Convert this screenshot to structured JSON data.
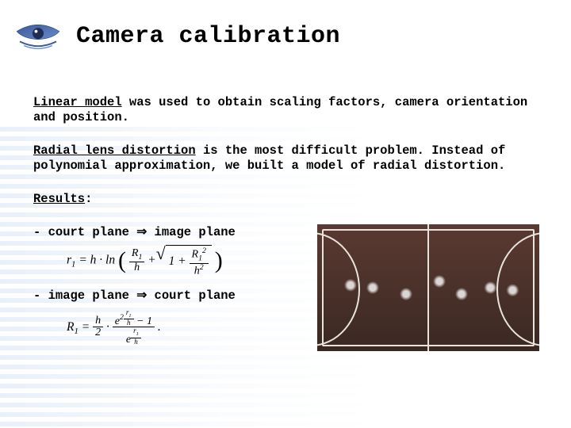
{
  "title": "Camera calibration",
  "body": {
    "p1_lead": "Linear model",
    "p1_rest": " was used to obtain scaling factors, camera orientation and position.",
    "p2_lead": "Radial lens distortion",
    "p2_rest": " is the most difficult problem. Instead of polynomial approximation, we built a model of radial distortion.",
    "results_label": "Results",
    "colon": ":",
    "map1_pre": "- court plane ",
    "map1_post": " image plane",
    "map2_pre": "- image plane ",
    "map2_post": " court plane",
    "arrow": "⇒"
  },
  "formulas": {
    "f1": {
      "lhs": "r",
      "lhs_sub": "1",
      "eq": " = h · ln",
      "frac1_num_a": "R",
      "frac1_num_sub": "1",
      "frac1_den": "h",
      "plus": " + ",
      "one_plus": "1 + ",
      "frac2_num_a": "R",
      "frac2_num_sub": "1",
      "frac2_num_sup": "2",
      "frac2_den_a": "h",
      "frac2_den_sup": "2"
    },
    "f2": {
      "lhs": "R",
      "lhs_sub": "1",
      "eq": " = ",
      "outer_num_h": "h",
      "outer_den": "2",
      "dot": " · ",
      "e": "e",
      "exp_prefix": "2",
      "exp_num": "r",
      "exp_num_sub": "1",
      "exp_den": "h",
      "minus1": " − 1",
      "lower_e": "e",
      "lower_exp_num": "r",
      "lower_exp_num_sub": "1",
      "lower_exp_den": "h",
      "period": "."
    }
  },
  "image": {
    "alt": "handball-court-overhead"
  }
}
